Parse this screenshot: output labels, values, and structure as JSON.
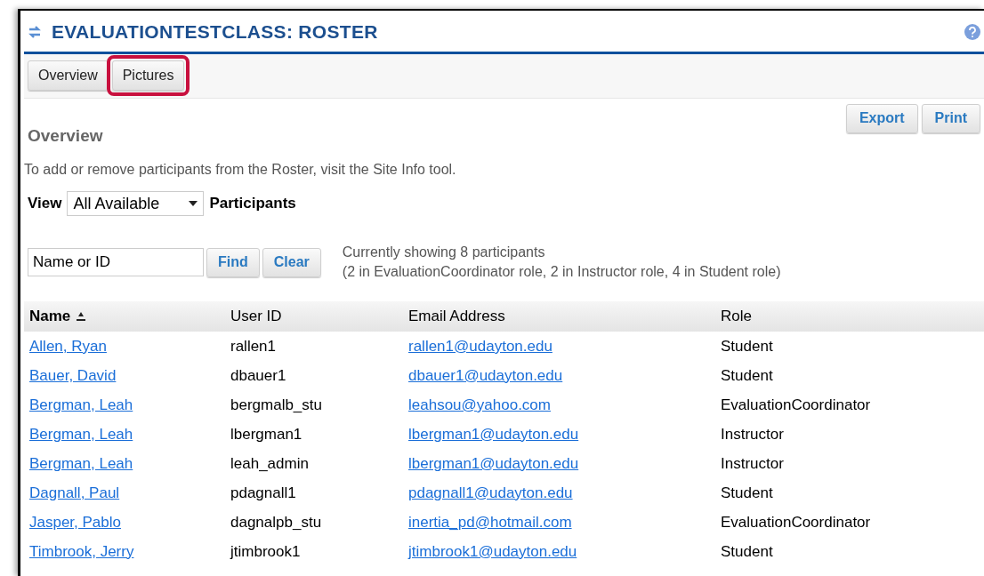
{
  "window": {
    "title": "EVALUATIONTESTCLASS: ROSTER"
  },
  "tabs": [
    {
      "label": "Overview",
      "highlighted": false
    },
    {
      "label": "Pictures",
      "highlighted": true
    }
  ],
  "actions": [
    "Export",
    "Print"
  ],
  "section_title": "Overview",
  "description": "To add or remove participants from the Roster, visit the Site Info tool.",
  "view": {
    "label": "View",
    "value": "All Available",
    "suffix": "Participants"
  },
  "search": {
    "value": "Name or ID",
    "buttons": [
      "Find",
      "Clear"
    ]
  },
  "summary": [
    "Currently showing 8 participants",
    "(2 in EvaluationCoordinator role, 2 in Instructor role, 4 in Student role)"
  ],
  "table": {
    "columns": [
      {
        "label": "Name",
        "sorted": true
      },
      {
        "label": "User ID",
        "sorted": false
      },
      {
        "label": "Email Address",
        "sorted": false
      },
      {
        "label": "Role",
        "sorted": false
      }
    ],
    "rows": [
      [
        "Allen, Ryan",
        "rallen1",
        "rallen1@udayton.edu",
        "Student"
      ],
      [
        "Bauer, David",
        "dbauer1",
        "dbauer1@udayton.edu",
        "Student"
      ],
      [
        "Bergman, Leah",
        "bergmalb_stu",
        "leahsou@yahoo.com",
        "EvaluationCoordinator"
      ],
      [
        "Bergman, Leah",
        "lbergman1",
        "lbergman1@udayton.edu",
        "Instructor"
      ],
      [
        "Bergman, Leah",
        "leah_admin",
        "lbergman1@udayton.edu",
        "Instructor"
      ],
      [
        "Dagnall, Paul",
        "pdagnall1",
        "pdagnall1@udayton.edu",
        "Student"
      ],
      [
        "Jasper, Pablo",
        "dagnalpb_stu",
        "inertia_pd@hotmail.com",
        "EvaluationCoordinator"
      ],
      [
        "Timbrook, Jerry",
        "jtimbrook1",
        "jtimbrook1@udayton.edu",
        "Student"
      ]
    ]
  }
}
